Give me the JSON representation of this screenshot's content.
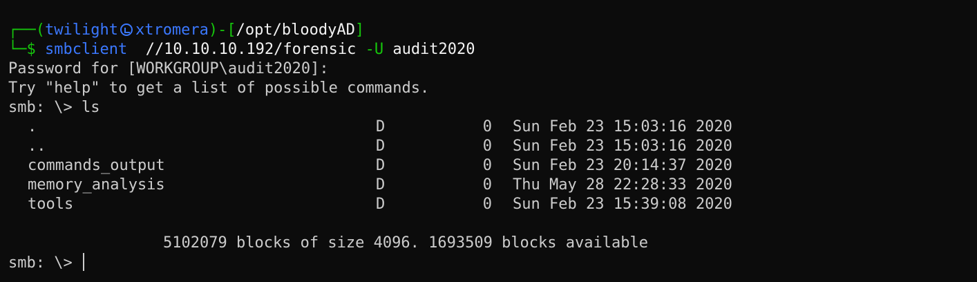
{
  "prompt": {
    "box_top": "┌──(",
    "user": "twilight",
    "host": "xtromera",
    "close_paren_dash": ")-[",
    "path": "/opt/bloodyAD",
    "close_bracket": "]",
    "box_bottom": "└─$ ",
    "command": "smbclient",
    "args_share": "  //10.10.10.192/forensic ",
    "flag": "-U",
    "flag_value": " audit2020"
  },
  "output": {
    "password_line": "Password for [WORKGROUP\\audit2020]:",
    "help_line": "Try \"help\" to get a list of possible commands.",
    "smb_ls_line": "smb: \\> ls",
    "listing": [
      {
        "name": ".",
        "type": "D",
        "size": "0",
        "date": "Sun Feb 23 15:03:16 2020"
      },
      {
        "name": "..",
        "type": "D",
        "size": "0",
        "date": "Sun Feb 23 15:03:16 2020"
      },
      {
        "name": "commands_output",
        "type": "D",
        "size": "0",
        "date": "Sun Feb 23 20:14:37 2020"
      },
      {
        "name": "memory_analysis",
        "type": "D",
        "size": "0",
        "date": "Thu May 28 22:28:33 2020"
      },
      {
        "name": "tools",
        "type": "D",
        "size": "0",
        "date": "Sun Feb 23 15:39:08 2020"
      }
    ],
    "blocks_line": "5102079 blocks of size 4096. 1693509 blocks available",
    "final_prompt": "smb: \\> "
  },
  "colors": {
    "background": "#0c0c0c",
    "text": "#cccccc",
    "green": "#16c60c",
    "blue": "#3b78ff"
  },
  "icons": {
    "user_host_separator": "skull-icon"
  }
}
